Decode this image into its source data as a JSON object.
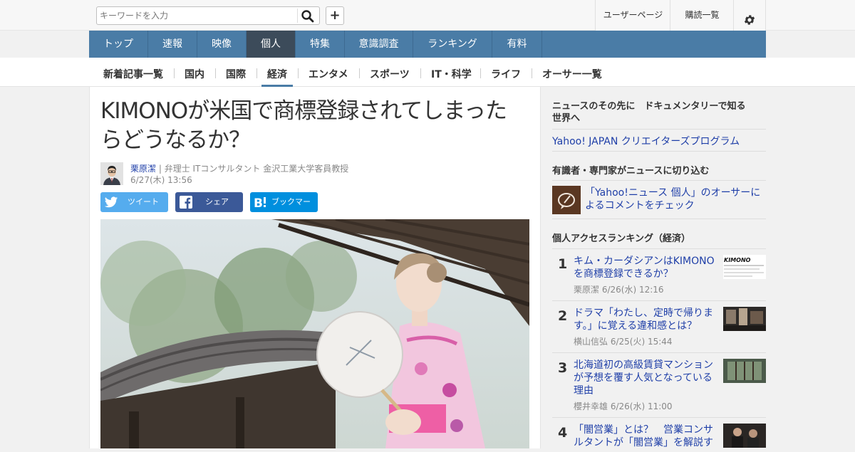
{
  "header": {
    "search_placeholder": "キーワードを入力",
    "add_label": "+",
    "user_page": "ユーザーページ",
    "subscribe_list": "購読一覧"
  },
  "main_nav": [
    "トップ",
    "速報",
    "映像",
    "個人",
    "特集",
    "意識調査",
    "ランキング",
    "有料"
  ],
  "main_nav_active": "個人",
  "sub_nav": [
    "新着記事一覧",
    "国内",
    "国際",
    "経済",
    "エンタメ",
    "スポーツ",
    "IT・科学",
    "ライフ",
    "オーサー一覧"
  ],
  "sub_nav_active": "経済",
  "article": {
    "title_line1": "KIMONOが米国で商標登録されてしまった",
    "title_line2": "らどうなるか？",
    "author": "栗原潔",
    "author_profile": "| 弁理士 ITコンサルタント 金沢工業大学客員教授",
    "date": "6/27(木) 13:56",
    "share": {
      "tweet": "ツイート",
      "facebook": "シェア",
      "hatena": "ブックマーク"
    }
  },
  "sidebar": {
    "promo_heading_line1": "ニュースのその先に　ドキュメンタリーで知る",
    "promo_heading_line2": "世界へ",
    "promo_link": "Yahoo! JAPAN クリエイターズプログラム",
    "experts_heading": "有識者・専門家がニュースに切り込む",
    "experts_text": "「Yahoo!ニュース 個人」のオーサーによるコメントをチェック",
    "ranking_heading": "個人アクセスランキング（経済）",
    "ranking": [
      {
        "rank": "1",
        "title": "キム・カーダシアンはKIMONOを商標登録できるか？",
        "meta": "栗原潔  6/26(水) 12:16",
        "thumb_text": "KIMONO"
      },
      {
        "rank": "2",
        "title": "ドラマ「わたし、定時で帰ります。」に覚える違和感とは？",
        "meta": "横山信弘  6/25(火) 15:44"
      },
      {
        "rank": "3",
        "title": "北海道初の高級賃貸マンションが予想を覆す人気となっている理由",
        "meta": "櫻井幸雄  6/26(水) 11:00"
      },
      {
        "rank": "4",
        "title": "「闇営業」とは？　営業コンサルタントが「闇営業」を解説す",
        "meta": ""
      }
    ]
  },
  "colors": {
    "nav_bg": "#4a7ca6",
    "nav_active": "#3c4b5a",
    "link": "#1f3fa8",
    "twitter": "#55acee",
    "facebook": "#3b5998",
    "hatena": "#008fde"
  }
}
